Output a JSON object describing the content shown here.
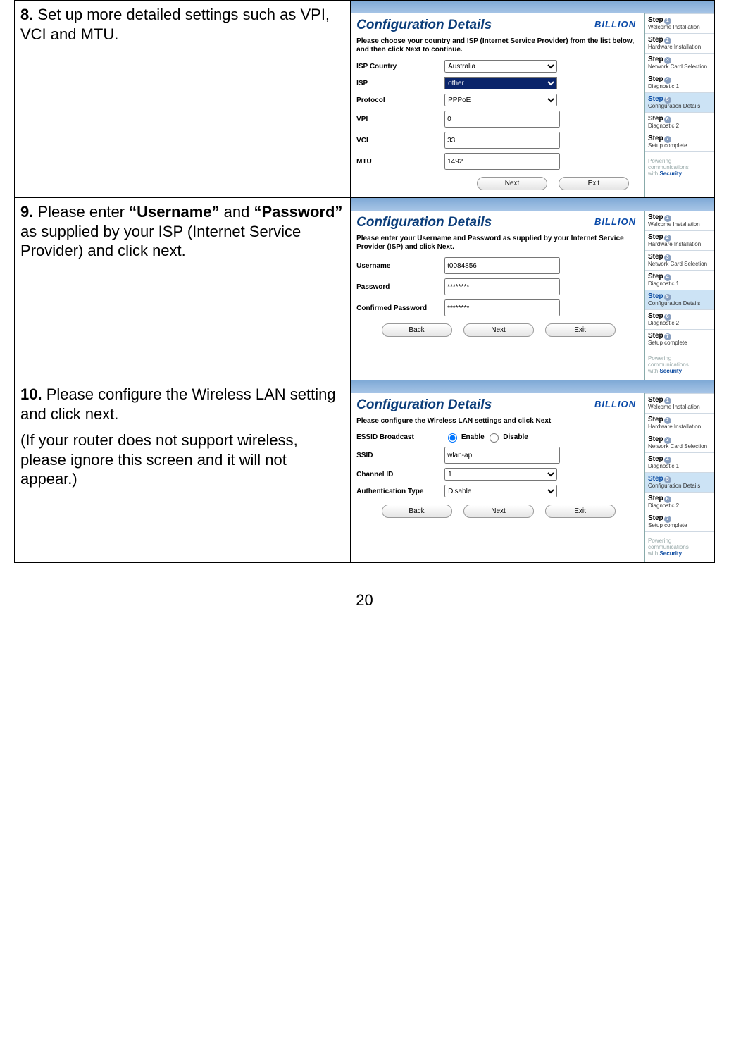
{
  "page_number": "20",
  "rows": [
    {
      "num": "8.",
      "text_html": "Set up more detailed settings such as VPI, VCI and MTU.",
      "shot": {
        "brand": "BILLION",
        "title": "Configuration Details",
        "blurb": "Please choose your country and ISP (Internet Service Provider) from the list below, and then click Next to continue.",
        "fields": [
          {
            "label": "ISP Country",
            "type": "select",
            "value": "Australia"
          },
          {
            "label": "ISP",
            "type": "select",
            "value": "other",
            "other": true
          },
          {
            "label": "Protocol",
            "type": "select",
            "value": "PPPoE"
          },
          {
            "label": "VPI",
            "type": "text",
            "value": "0"
          },
          {
            "label": "VCI",
            "type": "text",
            "value": "33"
          },
          {
            "label": "MTU",
            "type": "text",
            "value": "1492"
          }
        ],
        "buttons_align": "right",
        "buttons": [
          "Next",
          "Exit"
        ]
      }
    },
    {
      "num": "9.",
      "text_html": "Please enter <b>“Username”</b> and <b>“Password”</b> as supplied by your ISP (Internet Service Provider) and click next.",
      "shot": {
        "brand": "BILLION",
        "title": "Configuration Details",
        "blurb": "Please enter your Username and Password as supplied by your Internet Service Provider (ISP) and click Next.",
        "fields": [
          {
            "label": "Username",
            "type": "text",
            "value": "t0084856"
          },
          {
            "label": "Password",
            "type": "text",
            "value": "********"
          },
          {
            "label": "Confirmed Password",
            "type": "text",
            "value": "********"
          }
        ],
        "buttons_align": "center",
        "buttons": [
          "Back",
          "Next",
          "Exit"
        ]
      }
    },
    {
      "num": "10.",
      "text_html": "Please configure the Wireless LAN setting and click next.",
      "extra_text": "(If your router does not support wireless, please ignore this screen and it will not appear.)",
      "shot": {
        "brand": "BILLION",
        "title": "Configuration Details",
        "blurb": "Please configure the Wireless LAN settings and click Next",
        "fields": [
          {
            "label": "ESSID Broadcast",
            "type": "radio",
            "options": [
              "Enable",
              "Disable"
            ],
            "value": "Enable"
          },
          {
            "label": "SSID",
            "type": "text",
            "value": "wlan-ap"
          },
          {
            "label": "Channel ID",
            "type": "select",
            "value": "1"
          },
          {
            "label": "Authentication Type",
            "type": "select",
            "value": "Disable"
          }
        ],
        "buttons_align": "center",
        "buttons": [
          "Back",
          "Next",
          "Exit"
        ]
      }
    }
  ],
  "steps": [
    {
      "label": "Step",
      "sub": "Welcome Installation",
      "n": "1"
    },
    {
      "label": "Step",
      "sub": "Hardware Installation",
      "n": "2"
    },
    {
      "label": "Step",
      "sub": "Network Card Selection",
      "n": "3"
    },
    {
      "label": "Step",
      "sub": "Diagnostic 1",
      "n": "4"
    },
    {
      "label": "Step",
      "sub": "Configuration Details",
      "n": "5",
      "current": true
    },
    {
      "label": "Step",
      "sub": "Diagnostic 2",
      "n": "6"
    },
    {
      "label": "Step",
      "sub": "Setup complete",
      "n": "7"
    }
  ],
  "tagline": {
    "a": "Powering communications",
    "b": "with Security"
  }
}
